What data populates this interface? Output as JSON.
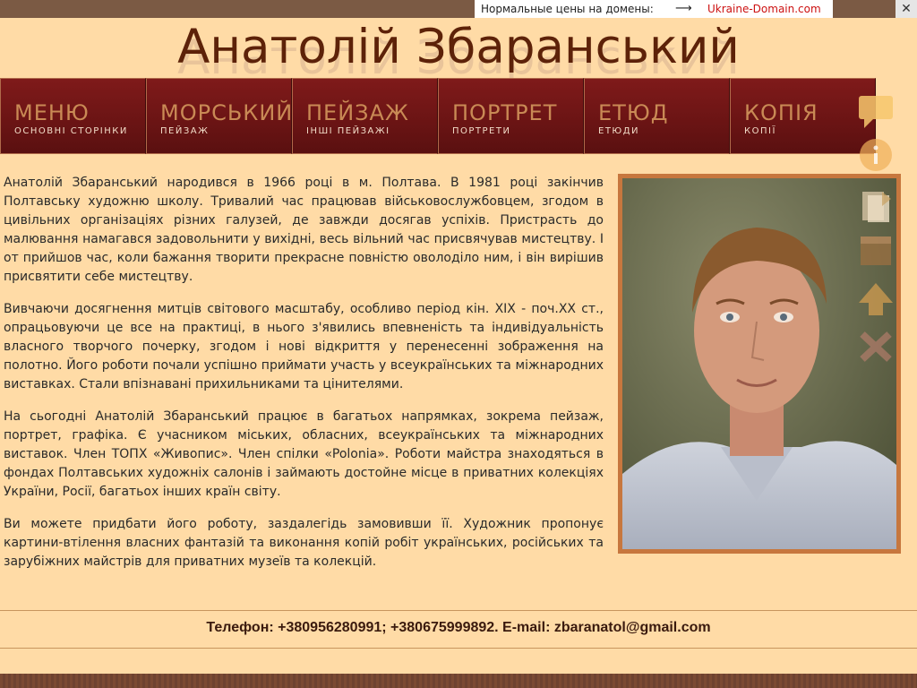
{
  "domain_bar": {
    "label": "Нормальные цены на домены:",
    "arrow": "⟶",
    "link": "Ukraine-Domain.com",
    "close": "✕"
  },
  "title": "Анатолій Збаранський",
  "nav": [
    {
      "label": "МЕНЮ",
      "sub": "ОСНОВНІ СТОРІНКИ"
    },
    {
      "label": "МОРСЬКИЙ",
      "sub": "ПЕЙЗАЖ"
    },
    {
      "label": "ПЕЙЗАЖ",
      "sub": "ІНШІ ПЕЙЗАЖІ"
    },
    {
      "label": "ПОРТРЕТ",
      "sub": "ПОРТРЕТИ"
    },
    {
      "label": "ЕТЮД",
      "sub": "ЕТЮДИ"
    },
    {
      "label": "КОПІЯ",
      "sub": "КОПІЇ"
    }
  ],
  "paragraphs": [
    "Анатолій Збаранський народився в 1966 році в м. Полтава. В 1981 році закінчив Полтавську художню школу. Тривалий час працював військовослужбовцем, згодом в цивільних організаціях різних галузей, де завжди досягав успіхів. Пристрасть до малювання намагався задовольнити у вихідні, весь вільний час присвячував мистецтву. І от прийшов час, коли бажання творити прекрасне повністю оволоділо ним, і він вирішив присвятити себе мистецтву.",
    "Вивчаючи досягнення митців світового масштабу, особливо період кін. XIX - поч.XX ст., опрацьовуючи це все на практиці, в нього з'явились впевненість та індивідуальність власного творчого почерку, згодом і нові відкриття у перенесенні зображення на полотно. Його роботи почали успішно приймати участь у всеукраїнських та міжнародних виставках. Стали впізнавані прихильниками та цінителями.",
    "На сьогодні Анатолій Збаранський працює в багатьох напрямках, зокрема пейзаж, портрет, графіка. Є учасником міських, обласних, всеукраїнських та міжнародних виставок. Член ТОПХ «Живопис». Член спілки «Polonia». Роботи майстра знаходяться в фондах Полтавських художніх салонів і займають достойне місце в приватних колекціях України, Росії, багатьох інших країн світу.",
    "Ви можете придбати його роботу, заздалегідь замовивши її. Художник пропонує картини-втілення власних фантазій та виконання копій робіт українських, російських та зарубіжних майстрів для приватних музеїв та колекцій."
  ],
  "footer": "Телефон: +380956280991; +380675999892. E-mail: zbaranatol@gmail.com",
  "side_icons": [
    "comment-icon",
    "info-icon",
    "document-icon",
    "video-icon",
    "arrow-up-icon",
    "close-icon"
  ],
  "colors": {
    "background": "#ffdba6",
    "nav": "#6a1414",
    "nav_label": "#c98a55",
    "title": "#5d2209",
    "photo_border": "#c7773e"
  }
}
